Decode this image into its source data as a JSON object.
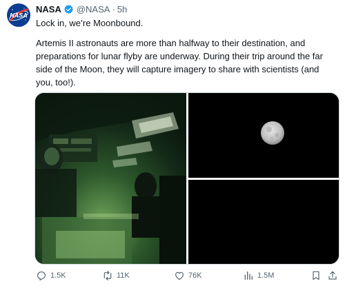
{
  "post": {
    "author_name": "NASA",
    "handle": "@NASA",
    "separator": "·",
    "time": "5h",
    "headline": "Lock in, we’re Moonbound.",
    "body_lines": [
      "Artemis II astronauts are more than halfway to their destination, and",
      "preparations for lunar flyby are underway. During their trip around the far",
      "side of the Moon, they will capture imagery to share with scientists (and",
      "you, too!)."
    ]
  },
  "stats": {
    "replies": "1.5K",
    "reposts": "11K",
    "likes": "76K",
    "views": "1.5M"
  },
  "icons": {
    "verified": "verified-badge-icon",
    "reply": "reply-icon",
    "repost": "repost-icon",
    "like": "heart-icon",
    "views": "views-chart-icon",
    "bookmark": "bookmark-icon",
    "share": "share-icon"
  },
  "colors": {
    "verified": "#1d9bf0",
    "text": "#0f1419",
    "secondary": "#536471",
    "nasa_blue": "#0b3d91",
    "nasa_red": "#fc3d21"
  }
}
